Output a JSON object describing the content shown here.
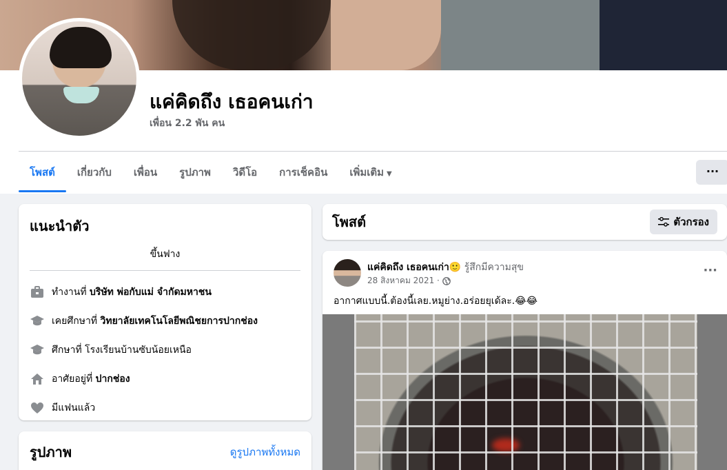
{
  "profile": {
    "name": "แค่คิดถึง เธอคนเก่า",
    "friends": "เพื่อน 2.2 พัน คน"
  },
  "tabs": [
    {
      "label": "โพสต์",
      "active": true
    },
    {
      "label": "เกี่ยวกับ"
    },
    {
      "label": "เพื่อน"
    },
    {
      "label": "รูปภาพ"
    },
    {
      "label": "วิดีโอ"
    },
    {
      "label": "การเช็คอิน"
    },
    {
      "label": "เพิ่มเติม"
    }
  ],
  "more_button": "···",
  "intro": {
    "title": "แนะนำตัว",
    "bio": "ขึ้นฟาง",
    "items": [
      {
        "icon": "briefcase-icon",
        "prefix": "ทำงานที่ ",
        "bold": "บริษัท พ่อกับแม่ จำกัดมหาชน"
      },
      {
        "icon": "graduation-cap-icon",
        "prefix": "เคยศึกษาที่ ",
        "bold": "วิทยาลัยเทคโนโลยีพณิชยการปากช่อง"
      },
      {
        "icon": "graduation-cap-icon",
        "prefix": "ศึกษาที่ โรงเรียนบ้านซับน้อยเหนือ",
        "bold": ""
      },
      {
        "icon": "home-icon",
        "prefix": "อาศัยอยู่ที่ ",
        "bold": "ปากช่อง"
      },
      {
        "icon": "heart-icon",
        "prefix": "มีแฟนแล้ว",
        "bold": ""
      }
    ]
  },
  "photos": {
    "title": "รูปภาพ",
    "see_all": "ดูรูปภาพทั้งหมด"
  },
  "posts_header": {
    "title": "โพสต์",
    "filter_label": "ตัวกรอง"
  },
  "post": {
    "author": "แค่คิดถึง เธอคนเก่า",
    "emoji": "🙂",
    "feeling": " รู้สึกมีความสุข",
    "date": "28 สิงหาคม 2021 ·",
    "text": "อากาศแบบนี้.ต้องนี้เลย.หมูย่าง.อร่อยยุเด้ละ.😂😂",
    "menu": "···"
  },
  "colors": {
    "accent": "#1877f2",
    "secondary_text": "#65676b",
    "background": "#f0f2f5"
  }
}
